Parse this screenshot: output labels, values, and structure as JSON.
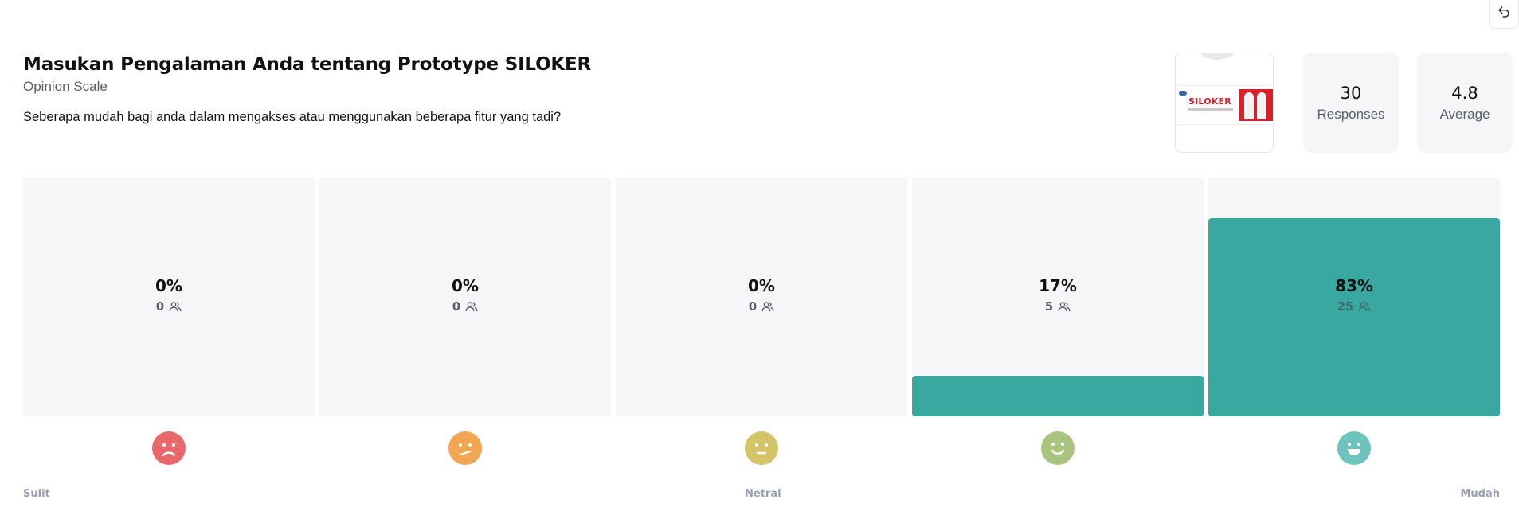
{
  "header": {
    "title": "Masukan Pengalaman Anda tentang Prototype SILOKER",
    "type": "Opinion Scale",
    "question": "Seberapa mudah bagi anda dalam mengakses atau menggunakan beberapa fitur yang tadi?"
  },
  "thumbnail": {
    "brand_text": "SILOKER"
  },
  "stats": {
    "responses": {
      "value": "30",
      "label": "Responses"
    },
    "average": {
      "value": "4.8",
      "label": "Average"
    }
  },
  "chart_data": {
    "type": "bar",
    "categories": [
      "1",
      "2",
      "3",
      "4",
      "5"
    ],
    "series": [
      {
        "values": [
          0,
          0,
          0,
          17,
          83
        ]
      }
    ],
    "counts": [
      0,
      0,
      0,
      5,
      25
    ],
    "ylim": [
      0,
      100
    ],
    "scale_labels": {
      "low": "Sulit",
      "mid": "Netral",
      "high": "Mudah"
    }
  },
  "bars": [
    {
      "pct": "0%",
      "count": "0",
      "fraction": 0.0,
      "face_color": "#e8686c",
      "face": "sad-face-icon"
    },
    {
      "pct": "0%",
      "count": "0",
      "fraction": 0.0,
      "face_color": "#f0a652",
      "face": "unsure-face-icon"
    },
    {
      "pct": "0%",
      "count": "0",
      "fraction": 0.0,
      "face_color": "#d4c468",
      "face": "neutral-face-icon"
    },
    {
      "pct": "17%",
      "count": "5",
      "fraction": 0.17,
      "face_color": "#a8c47e",
      "face": "smile-face-icon"
    },
    {
      "pct": "83%",
      "count": "25",
      "fraction": 0.83,
      "face_color": "#6cc4bc",
      "face": "grin-face-icon"
    }
  ],
  "scale": {
    "low": "Sulit",
    "mid": "Netral",
    "high": "Mudah"
  },
  "colors": {
    "accent": "#38a8a0",
    "card_bg": "#f6f6f8",
    "muted_text": "#5a5f6e",
    "scale_label": "#9a9fb5"
  },
  "icons": {
    "back": "undo-arrow-icon",
    "people": "people-icon"
  }
}
